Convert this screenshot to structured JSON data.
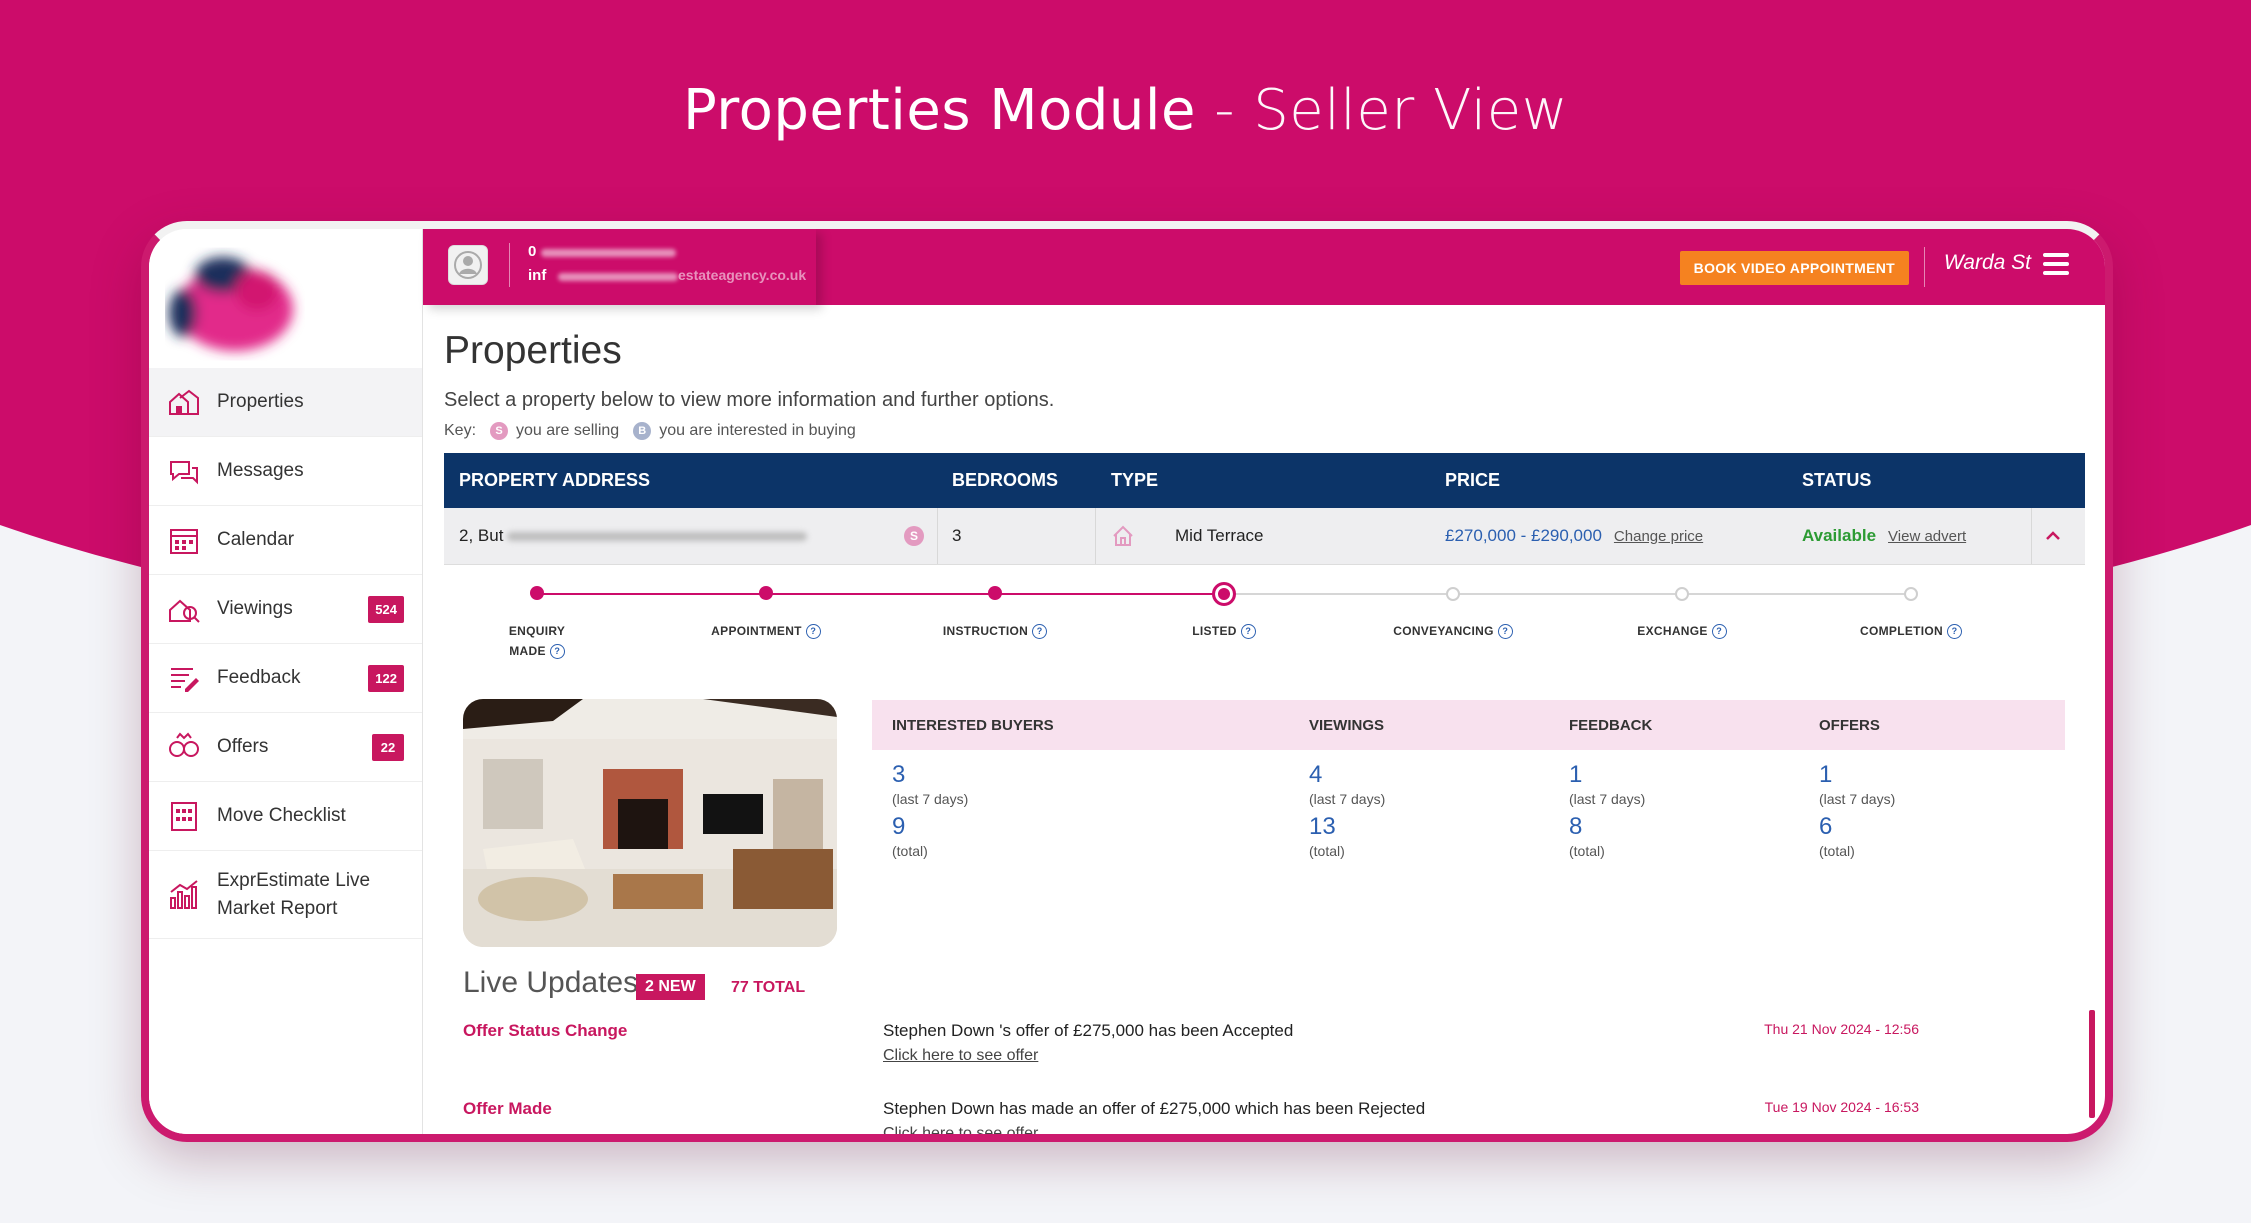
{
  "hero": {
    "title_strong": "Properties Module",
    "title_light": " - Seller View",
    "colors": {
      "magenta": "#cc0c6a",
      "background": "#f3f4f8"
    }
  },
  "topbar": {
    "phone": "0",
    "email": "inf",
    "email_tail": "estateagency.co.uk",
    "book_button": "BOOK VIDEO APPOINTMENT",
    "branch": "Warda St",
    "menu_icon": "hamburger-icon"
  },
  "sidebar": {
    "items": [
      {
        "label": "Properties",
        "icon": "properties-icon",
        "badge": ""
      },
      {
        "label": "Messages",
        "icon": "messages-icon",
        "badge": ""
      },
      {
        "label": "Calendar",
        "icon": "calendar-icon",
        "badge": ""
      },
      {
        "label": "Viewings",
        "icon": "viewings-icon",
        "badge": "524"
      },
      {
        "label": "Feedback",
        "icon": "feedback-icon",
        "badge": "122"
      },
      {
        "label": "Offers",
        "icon": "offers-icon",
        "badge": "22"
      },
      {
        "label": "Move Checklist",
        "icon": "checklist-icon",
        "badge": ""
      },
      {
        "label": "ExprEstimate Live Market Report",
        "icon": "report-icon",
        "badge": ""
      }
    ]
  },
  "page": {
    "title": "Properties",
    "subtitle": "Select a property below to view more information and further options.",
    "key_label": "Key:",
    "key_selling_letter": "S",
    "key_selling": "you are selling",
    "key_buying_letter": "B",
    "key_buying": "you are interested in buying"
  },
  "table": {
    "headers": {
      "address": "PROPERTY ADDRESS",
      "bedrooms": "BEDROOMS",
      "type": "TYPE",
      "price": "PRICE",
      "status": "STATUS"
    },
    "row": {
      "address": "2, But",
      "badge": "S",
      "bedrooms": "3",
      "type": "Mid Terrace",
      "price": "£270,000 - £290,000",
      "change_price": "Change price",
      "status": "Available",
      "view_advert": "View advert"
    }
  },
  "progress": {
    "steps": [
      {
        "label": "ENQUIRY",
        "label2": "MADE",
        "state": "done"
      },
      {
        "label": "APPOINTMENT",
        "label2": "",
        "state": "done"
      },
      {
        "label": "INSTRUCTION",
        "label2": "",
        "state": "done"
      },
      {
        "label": "LISTED",
        "label2": "",
        "state": "current"
      },
      {
        "label": "CONVEYANCING",
        "label2": "",
        "state": "open"
      },
      {
        "label": "EXCHANGE",
        "label2": "",
        "state": "open"
      },
      {
        "label": "COMPLETION",
        "label2": "",
        "state": "open"
      }
    ],
    "current_step_index": 3,
    "help_icon": "?"
  },
  "stats": {
    "headers": [
      "INTERESTED BUYERS",
      "VIEWINGS",
      "FEEDBACK",
      "OFFERS"
    ],
    "week": [
      "3",
      "4",
      "1",
      "1"
    ],
    "total": [
      "9",
      "13",
      "8",
      "6"
    ],
    "week_caption": "(last 7 days)",
    "total_caption": "(total)"
  },
  "live_updates": {
    "title": "Live Updates",
    "new_badge": "2 NEW",
    "total": "77 TOTAL",
    "items": [
      {
        "type": "Offer Status Change",
        "text": "Stephen Down 's offer of £275,000 has been Accepted",
        "link": "Click here to see offer",
        "date": "Thu 21 Nov 2024 - 12:56"
      },
      {
        "type": "Offer Made",
        "text": "Stephen Down has made an offer of £275,000 which has been Rejected",
        "link": "Click here to see offer",
        "date": "Tue 19 Nov 2024 - 16:53"
      }
    ]
  }
}
